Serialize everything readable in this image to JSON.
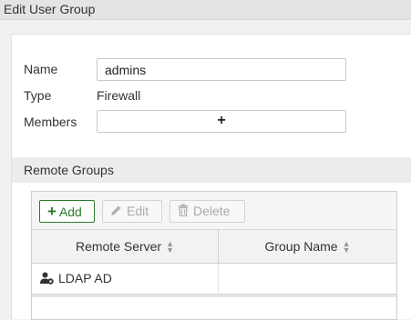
{
  "window": {
    "title": "Edit User Group"
  },
  "form": {
    "name_label": "Name",
    "name_value": "admins",
    "type_label": "Type",
    "type_value": "Firewall",
    "members_label": "Members",
    "members_add_symbol": "+"
  },
  "remote_groups": {
    "section_title": "Remote Groups",
    "toolbar": {
      "add_label": "Add",
      "edit_label": "Edit",
      "delete_label": "Delete",
      "add_icon": "plus-icon",
      "edit_icon": "pencil-icon",
      "delete_icon": "trash-icon"
    },
    "columns": [
      "Remote Server",
      "Group Name"
    ],
    "rows": [
      {
        "remote_server": "LDAP AD",
        "group_name": "",
        "icon": "ldap-user-icon"
      }
    ]
  },
  "colors": {
    "add_accent": "#2b7a2b",
    "disabled_text": "#a9a9a9"
  }
}
